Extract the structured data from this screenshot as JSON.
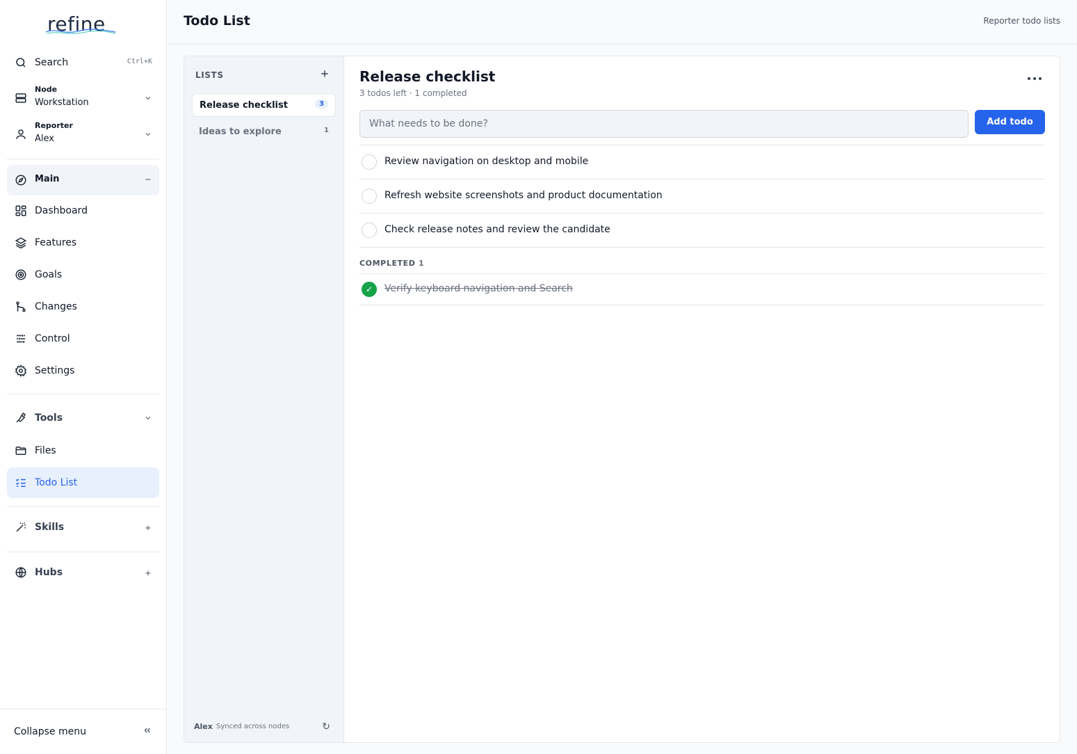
{
  "app": {
    "logo_text": "refine"
  },
  "sidebar": {
    "search": {
      "label": "Search",
      "shortcut": "Ctrl+K"
    },
    "node": {
      "label": "Node",
      "value": "Workstation"
    },
    "reporter": {
      "label": "Reporter",
      "value": "Alex"
    },
    "main_group": "Main",
    "items": [
      {
        "label": "Dashboard",
        "icon": "dashboard-icon"
      },
      {
        "label": "Features",
        "icon": "layers-icon"
      },
      {
        "label": "Goals",
        "icon": "target-icon"
      },
      {
        "label": "Changes",
        "icon": "git-branch-icon"
      },
      {
        "label": "Control",
        "icon": "sliders-icon"
      },
      {
        "label": "Settings",
        "icon": "gear-icon"
      }
    ],
    "tools": "Tools",
    "files": "Files",
    "todo_list": "Todo List",
    "skills": "Skills",
    "hubs": "Hubs",
    "collapse": "Collapse menu"
  },
  "header": {
    "title": "Todo List",
    "right_text": "Reporter todo lists"
  },
  "lists": {
    "title": "LISTS",
    "items": [
      {
        "name": "Release checklist",
        "count": "3"
      },
      {
        "name": "Ideas to explore",
        "count": "1"
      }
    ],
    "sync_user": "Alex",
    "sync_text": "Synced across nodes"
  },
  "list_detail": {
    "title": "Release checklist",
    "subtitle": "3 todos left · 1 completed",
    "input_placeholder": "What needs to be done?",
    "add_label": "Add todo",
    "todos": [
      "Review navigation on desktop and mobile",
      "Refresh website screenshots and product documentation",
      "Check release notes and review the candidate"
    ],
    "completed_label": "COMPLETED",
    "completed_count": "1",
    "completed": [
      "Verify keyboard navigation and Search"
    ]
  },
  "colors": {
    "accent": "#2563eb",
    "success": "#16a34a",
    "sidebar_active_bg": "#e8f0fe"
  }
}
